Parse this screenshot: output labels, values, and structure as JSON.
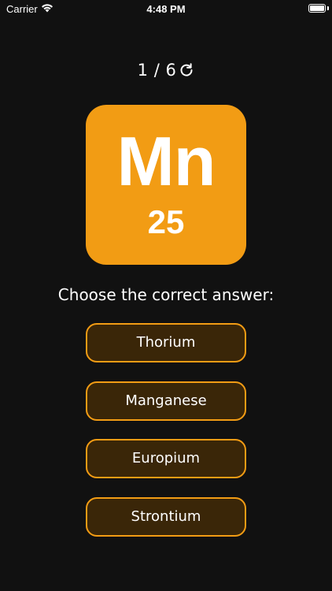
{
  "status_bar": {
    "carrier": "Carrier",
    "time": "4:48 PM",
    "wifi_icon": "wifi-icon",
    "battery_icon": "battery-icon"
  },
  "quiz": {
    "progress": "1 / 6",
    "reload_icon": "reload-icon",
    "accent_color": "#f29c14",
    "button_bg_color": "#3a2608",
    "background_color": "#111111"
  },
  "element": {
    "symbol": "Mn",
    "atomic_number": "25"
  },
  "prompt": "Choose the correct answer:",
  "answers": [
    {
      "label": "Thorium"
    },
    {
      "label": "Manganese"
    },
    {
      "label": "Europium"
    },
    {
      "label": "Strontium"
    }
  ]
}
